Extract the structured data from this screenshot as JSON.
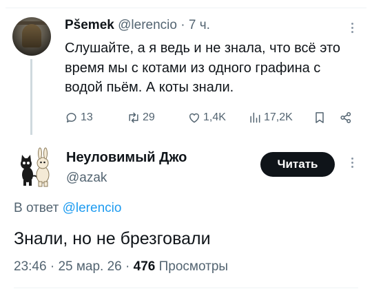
{
  "parent_tweet": {
    "display_name": "Pšemek",
    "handle": "@lerencio",
    "separator": "·",
    "time": "7 ч.",
    "text": "Слушайте, а я ведь и не знала, что всё это время мы с котами из одного графина с водой пьём. А коты знали.",
    "replies": "13",
    "retweets": "29",
    "likes": "1,4K",
    "views": "17,2K"
  },
  "reply_tweet": {
    "display_name": "Неуловимый Джо",
    "handle": "@azak",
    "follow_label": "Читать",
    "reply_to_prefix": "В ответ",
    "reply_to_handle": "@lerencio",
    "text": "Знали, но не брезговали",
    "time": "23:46",
    "separator": "·",
    "date": "25 мар. 26",
    "views_count": "476",
    "views_label": "Просмотры"
  },
  "colors": {
    "text_primary": "#0f1419",
    "text_secondary": "#536471",
    "link": "#1d9bf0",
    "button_bg": "#0f1419",
    "thread_line": "#cfd9de"
  },
  "icons": [
    "reply-icon",
    "retweet-icon",
    "like-icon",
    "views-icon",
    "bookmark-icon",
    "share-icon",
    "more-icon"
  ]
}
